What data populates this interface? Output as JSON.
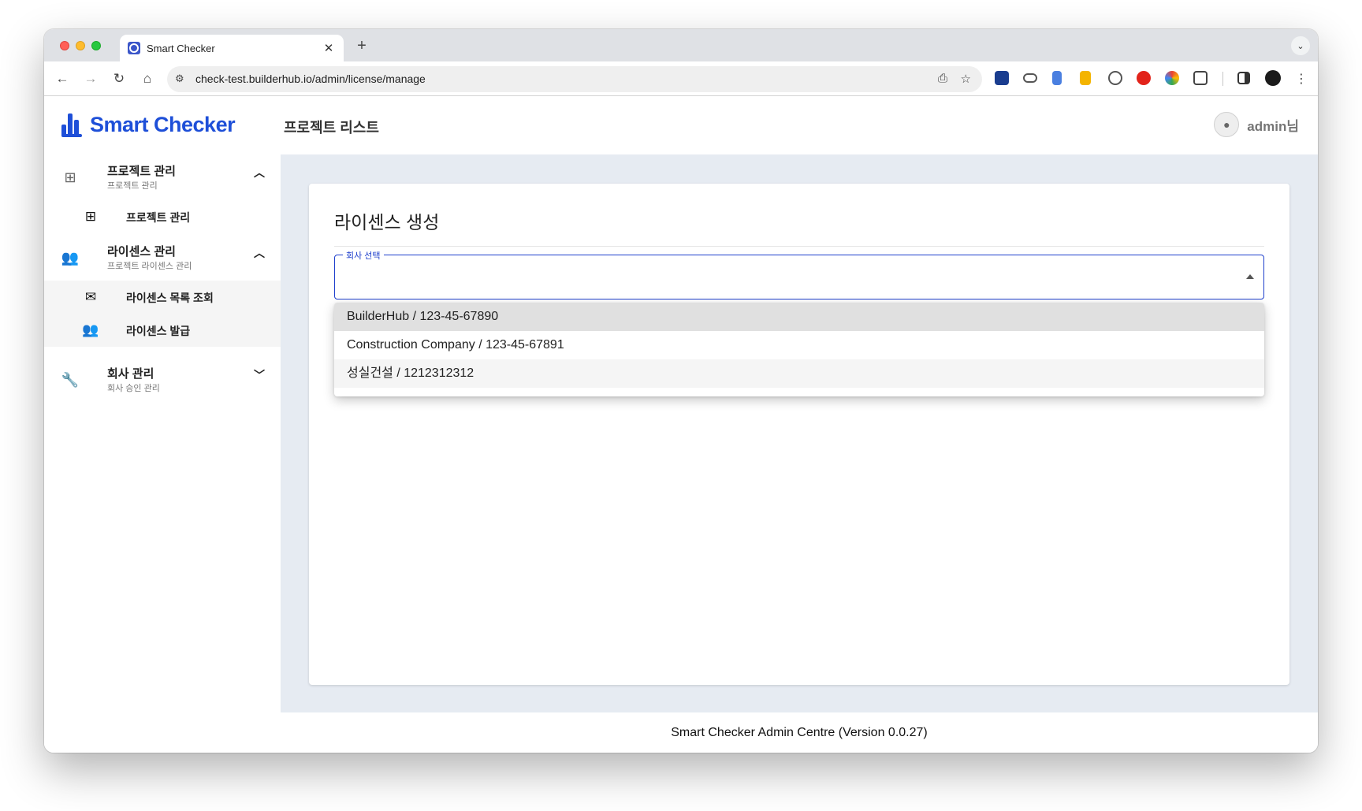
{
  "browser": {
    "tab_title": "Smart Checker",
    "tab_close": "✕",
    "new_tab": "+",
    "url": "check-test.builderhub.io/admin/license/manage"
  },
  "app": {
    "brand": "Smart Checker",
    "page_heading": "프로젝트 리스트",
    "user_name": "admin님"
  },
  "sidebar": {
    "groups": [
      {
        "title": "프로젝트 관리",
        "subtitle": "프로젝트 관리",
        "expanded": true,
        "items": [
          {
            "label": "프로젝트 관리"
          }
        ]
      },
      {
        "title": "라이센스 관리",
        "subtitle": "프로젝트 라이센스 관리",
        "expanded": true,
        "items": [
          {
            "label": "라이센스 목록 조회"
          },
          {
            "label": "라이센스 발급"
          }
        ]
      },
      {
        "title": "회사 관리",
        "subtitle": "회사 승인 관리",
        "expanded": false,
        "items": []
      }
    ]
  },
  "main": {
    "card_title": "라이센스 생성",
    "company_select": {
      "label": "회사 선택",
      "value": "",
      "options": [
        {
          "label": "BuilderHub / 123-45-67890",
          "state": "selected"
        },
        {
          "label": "Construction Company / 123-45-67891",
          "state": "normal"
        },
        {
          "label": "성실건설 / 1212312312",
          "state": "hover"
        }
      ]
    }
  },
  "footer": {
    "text": "Smart Checker Admin Centre (Version 0.0.27)"
  },
  "colors": {
    "brand": "#1e4fd8",
    "focus": "#1e3fcc",
    "content_bg": "#e6ebf2"
  }
}
